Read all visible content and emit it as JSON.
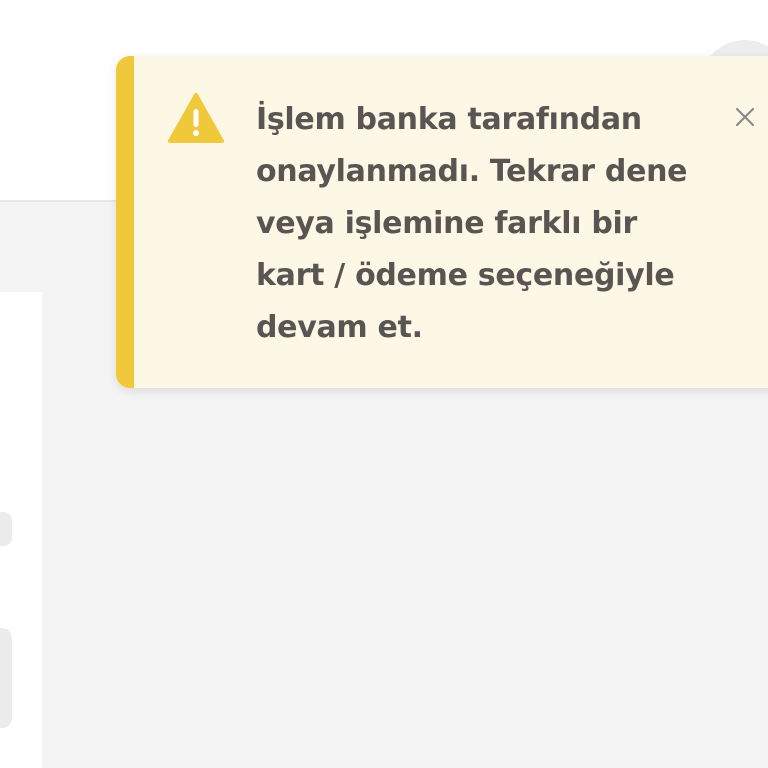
{
  "toast": {
    "type": "warning",
    "icon": "warning-triangle-icon",
    "message": "İşlem banka tarafından onaylanmadı. Tekrar dene veya işlemine farklı bir kart / ödeme seçeneğiyle devam et.",
    "close_icon": "close-icon",
    "colors": {
      "background": "#fdf7e6",
      "accent": "#f0c93a",
      "text": "#595552",
      "close": "#8a8a8a"
    }
  },
  "page": {
    "colors": {
      "header_background": "#ffffff",
      "content_background": "#f4f4f5"
    }
  }
}
